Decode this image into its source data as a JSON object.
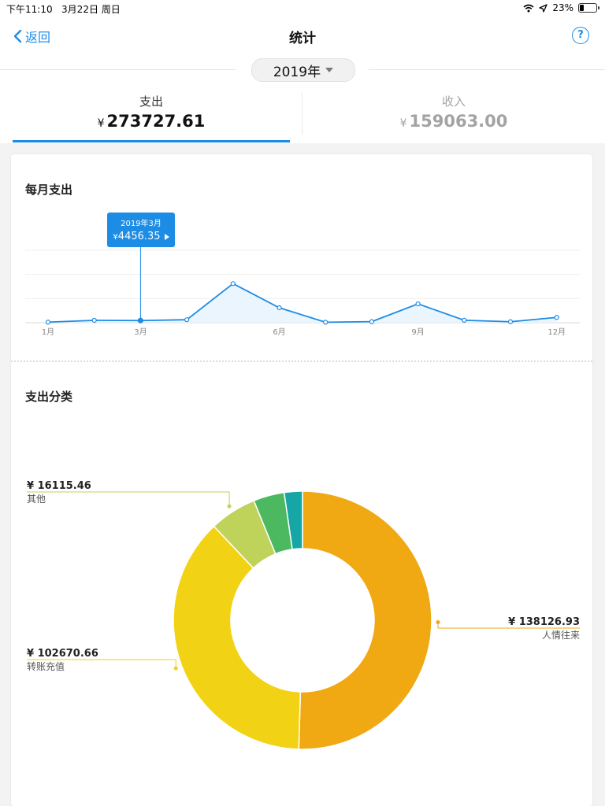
{
  "status_bar": {
    "time": "下午11:10",
    "date": "3月22日 周日",
    "battery": "23%",
    "battery_level": 0.23
  },
  "nav": {
    "back_label": "返回",
    "title": "统计",
    "help_glyph": "?"
  },
  "year_selector": {
    "value": "2019年"
  },
  "tabs": [
    {
      "label": "支出",
      "currency": "¥",
      "amount": "273727.61",
      "active": true
    },
    {
      "label": "收入",
      "currency": "¥",
      "amount": "159063.00",
      "active": false
    }
  ],
  "colors": {
    "accent": "#1c8ce5",
    "slice_1": "#f0a813",
    "slice_2": "#f2d214",
    "slice_3": "#bfd35b",
    "slice_4": "#4cb860",
    "slice_5": "#15a6a5"
  },
  "monthly": {
    "title": "每月支出",
    "tooltip": {
      "period": "2019年3月",
      "currency": "¥",
      "value": "4456.35"
    }
  },
  "category": {
    "title": "支出分类",
    "labels": [
      {
        "currency": "¥",
        "amount": "16115.46",
        "name": "其他"
      },
      {
        "currency": "¥",
        "amount": "138126.93",
        "name": "人情往来"
      },
      {
        "currency": "¥",
        "amount": "102670.66",
        "name": "转账充值"
      }
    ]
  },
  "chart_data": [
    {
      "type": "area",
      "title": "每月支出",
      "x": [
        1,
        2,
        3,
        4,
        5,
        6,
        7,
        8,
        9,
        10,
        11,
        12
      ],
      "x_tick_labels": [
        "1月",
        "3月",
        "6月",
        "9月",
        "12月"
      ],
      "x_tick_positions": [
        1,
        3,
        6,
        9,
        12
      ],
      "series": [
        {
          "values": [
            1200,
            4900,
            4456.35,
            6200,
            81000,
            31000,
            1000,
            2200,
            39000,
            5100,
            2000,
            11000
          ]
        }
      ],
      "ylim": [
        0,
        150000
      ],
      "grid": true,
      "highlight_index": 2
    },
    {
      "type": "pie",
      "title": "支出分类",
      "donut": true,
      "labels": [
        "人情往来",
        "转账充值",
        "其他",
        "",
        ""
      ],
      "values": [
        138126.93,
        102670.66,
        16115.46,
        10600,
        6214.56
      ]
    }
  ]
}
